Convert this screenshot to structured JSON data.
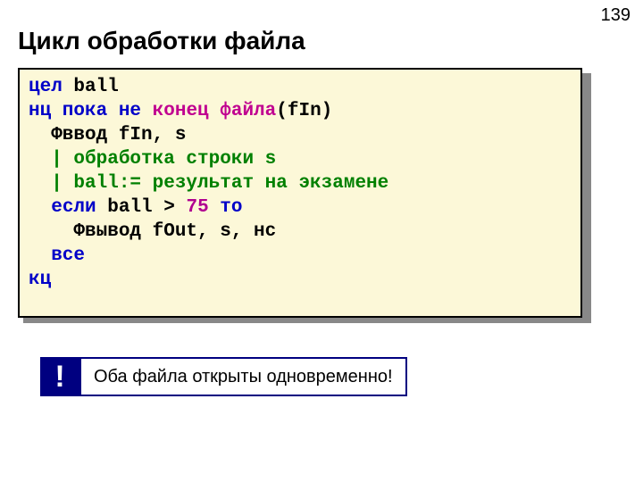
{
  "pageNumber": "139",
  "title": "Цикл обработки файла",
  "note": {
    "bang": "!",
    "text": "Оба файла открыты одновременно!"
  },
  "code": {
    "l1": {
      "kw": "цел",
      "rest": " ball"
    },
    "l2": {
      "kw1": "нц пока не",
      "fn": " конец файла",
      "rest": "(fIn)"
    },
    "l3": "  Фввод fIn, s",
    "l4": "  | обработка строки s",
    "l5": "  | ball:= результат на экзамене",
    "l6": {
      "pre": "  ",
      "kw1": "если",
      "mid": " ball > ",
      "num": "75",
      "sp": " ",
      "kw2": "то"
    },
    "l7": "    Фвывод fOut, s, нс",
    "l8": "  все",
    "l9": "кц"
  }
}
